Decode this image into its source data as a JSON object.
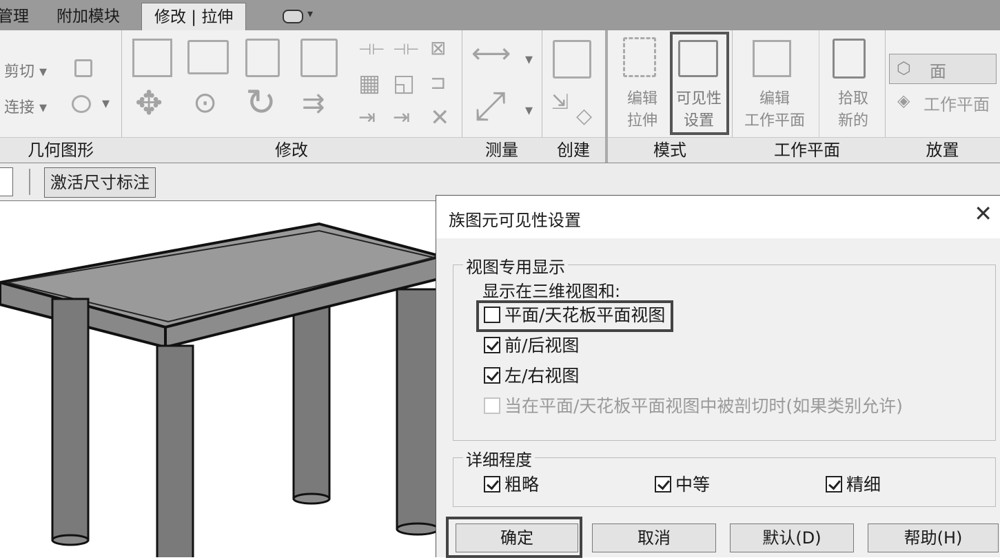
{
  "tabs": [
    {
      "label": "管理",
      "active": false
    },
    {
      "label": "附加模块",
      "active": false
    },
    {
      "label": "修改 | 拉伸",
      "active": true
    }
  ],
  "ribbon": {
    "geometry": {
      "title": "几何图形",
      "cut_label": "剪切",
      "join_label": "连接"
    },
    "modify": {
      "title": "修改"
    },
    "measure": {
      "title": "测量"
    },
    "create": {
      "title": "创建"
    },
    "mode": {
      "title": "模式",
      "edit_extrusion": [
        "编辑",
        "拉伸"
      ],
      "visibility_settings": [
        "可见性",
        "设置"
      ]
    },
    "workplane": {
      "title": "工作平面",
      "edit_workplane": [
        "编辑",
        "工作平面"
      ],
      "pick_new": [
        "拾取",
        "新的"
      ]
    },
    "place": {
      "title": "放置",
      "face_label": "面",
      "workplane_label": "工作平面"
    }
  },
  "options_bar": {
    "activate_dimensions_label": "激活尺寸标注"
  },
  "dialog": {
    "title": "族图元可见性设置",
    "view_specific_group": {
      "title": "视图专用显示",
      "subtitle": "显示在三维视图和:",
      "options": [
        {
          "label": "平面/天花板平面视图",
          "checked": false,
          "disabled": false
        },
        {
          "label": "前/后视图",
          "checked": true,
          "disabled": false
        },
        {
          "label": "左/右视图",
          "checked": true,
          "disabled": false
        },
        {
          "label": "当在平面/天花板平面视图中被剖切时(如果类别允许)",
          "checked": false,
          "disabled": true
        }
      ]
    },
    "detail_group": {
      "title": "详细程度",
      "options": [
        {
          "label": "粗略",
          "checked": true
        },
        {
          "label": "中等",
          "checked": true
        },
        {
          "label": "精细",
          "checked": true
        }
      ]
    },
    "buttons": {
      "ok": "确定",
      "cancel": "取消",
      "default": "默认(D)",
      "help": "帮助(H)"
    }
  }
}
